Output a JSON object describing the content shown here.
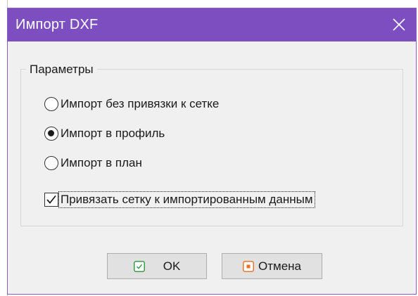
{
  "dialog": {
    "title": "Импорт DXF"
  },
  "parameters": {
    "legend": "Параметры",
    "options": [
      {
        "label": "Импорт без привязки к сетке",
        "checked": false
      },
      {
        "label": "Импорт в профиль",
        "checked": true
      },
      {
        "label": "Импорт в план",
        "checked": false
      }
    ],
    "snap_checkbox": {
      "label": "Привязать сетку к импортированным данным",
      "checked": true
    }
  },
  "buttons": {
    "ok_label": "OK",
    "cancel_label": "Отмена"
  },
  "colors": {
    "titlebar": "#7c4ec0",
    "ok_icon": "#3a9a48",
    "cancel_icon": "#e8742a"
  },
  "icons": {
    "close": "close-icon",
    "ok": "checkmark-icon",
    "cancel": "cancel-icon"
  }
}
